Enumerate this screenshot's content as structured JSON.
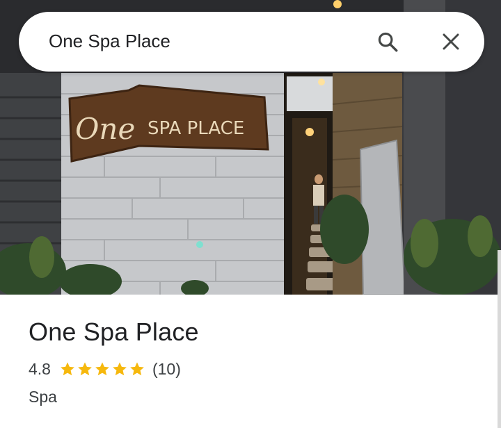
{
  "search": {
    "query": "One Spa Place"
  },
  "photo": {
    "sign_script": "One",
    "sign_text": "SPA PLACE"
  },
  "place": {
    "name": "One Spa Place",
    "rating": "4.8",
    "stars": 5,
    "review_count": "(10)",
    "category": "Spa"
  },
  "colors": {
    "star": "#F6B80D",
    "text_primary": "#202124",
    "text_secondary": "#3c4043"
  },
  "icons": {
    "search": "search-icon",
    "close": "close-icon"
  }
}
